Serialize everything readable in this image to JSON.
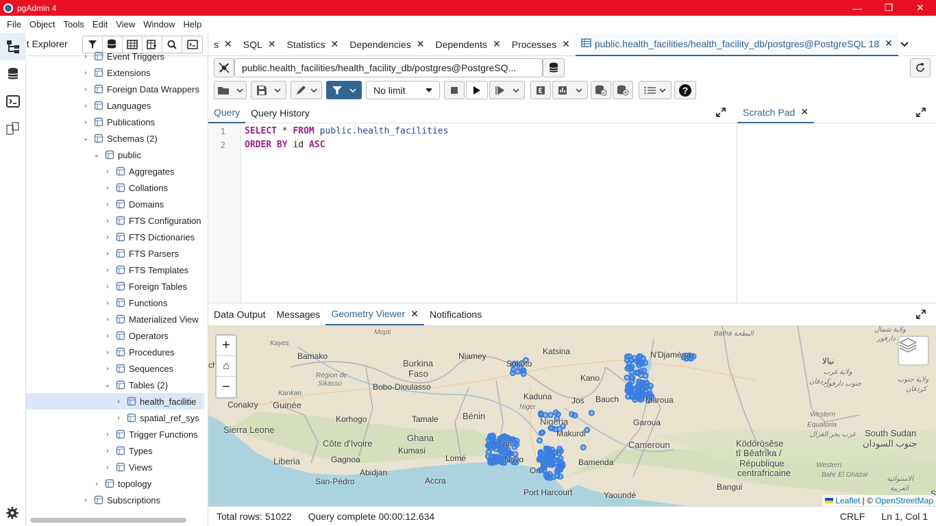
{
  "window": {
    "title": "pgAdmin 4",
    "controls": [
      "—",
      "❐",
      "✕"
    ]
  },
  "menu": [
    "File",
    "Object",
    "Tools",
    "Edit",
    "View",
    "Window",
    "Help"
  ],
  "browser": {
    "title": "ect Explorer",
    "tree": [
      {
        "label": "Event Triggers",
        "chev": "›",
        "icon": "event-triggers-icon"
      },
      {
        "label": "Extensions",
        "chev": "›",
        "icon": "extensions-icon"
      },
      {
        "label": "Foreign Data Wrappers",
        "chev": "›",
        "icon": "foreign-data-wrappers-icon"
      },
      {
        "label": "Languages",
        "chev": "›",
        "icon": "languages-icon"
      },
      {
        "label": "Publications",
        "chev": "›",
        "icon": "publications-icon"
      },
      {
        "label": "Schemas (2)",
        "chev": "⌄",
        "icon": "schemas-icon"
      },
      {
        "label": "public",
        "chev": "⌄",
        "icon": "schema-public-icon"
      },
      {
        "label": "Aggregates",
        "chev": "›",
        "icon": "aggregates-icon"
      },
      {
        "label": "Collations",
        "chev": "›",
        "icon": "collations-icon"
      },
      {
        "label": "Domains",
        "chev": "›",
        "icon": "domains-icon"
      },
      {
        "label": "FTS Configuration",
        "chev": "›",
        "icon": "fts-configuration-icon"
      },
      {
        "label": "FTS Dictionaries",
        "chev": "›",
        "icon": "fts-dictionaries-icon"
      },
      {
        "label": "FTS Parsers",
        "chev": "›",
        "icon": "fts-parsers-icon"
      },
      {
        "label": "FTS Templates",
        "chev": "›",
        "icon": "fts-templates-icon"
      },
      {
        "label": "Foreign Tables",
        "chev": "›",
        "icon": "foreign-tables-icon"
      },
      {
        "label": "Functions",
        "chev": "›",
        "icon": "functions-icon"
      },
      {
        "label": "Materialized View",
        "chev": "›",
        "icon": "materialized-views-icon"
      },
      {
        "label": "Operators",
        "chev": "›",
        "icon": "operators-icon"
      },
      {
        "label": "Procedures",
        "chev": "›",
        "icon": "procedures-icon"
      },
      {
        "label": "Sequences",
        "chev": "›",
        "icon": "sequences-icon"
      },
      {
        "label": "Tables (2)",
        "chev": "⌄",
        "icon": "tables-icon"
      },
      {
        "label": "health_facilitie",
        "chev": "›",
        "icon": "table-icon"
      },
      {
        "label": "spatial_ref_sys",
        "chev": "›",
        "icon": "table-icon"
      },
      {
        "label": "Trigger Functions",
        "chev": "›",
        "icon": "trigger-functions-icon"
      },
      {
        "label": "Types",
        "chev": "›",
        "icon": "types-icon"
      },
      {
        "label": "Views",
        "chev": "›",
        "icon": "views-icon"
      },
      {
        "label": "topology",
        "chev": "›",
        "icon": "schema-topology-icon"
      },
      {
        "label": "Subscriptions",
        "chev": "›",
        "icon": "subscriptions-icon"
      }
    ]
  },
  "tabs": [
    {
      "label": "s",
      "close": "✕"
    },
    {
      "label": "SQL",
      "close": "✕"
    },
    {
      "label": "Statistics",
      "close": "✕"
    },
    {
      "label": "Dependencies",
      "close": "✕"
    },
    {
      "label": "Dependents",
      "close": "✕"
    },
    {
      "label": "Processes",
      "close": "✕"
    },
    {
      "label": "public.health_facilities/health_facility_db/postgres@PostgreSQL 18",
      "close": "✕",
      "active": true
    }
  ],
  "connection": {
    "label": "public.health_facilities/health_facility_db/postgres@PostgreSQ..."
  },
  "toolbar": {
    "limit": "No limit"
  },
  "editor": {
    "tabs": [
      "Query",
      "Query History"
    ],
    "lines": [
      {
        "num": "1",
        "kw1": "SELECT",
        "plain": " * ",
        "kw2": "FROM",
        "ident": " public.health_facilities"
      },
      {
        "num": "2",
        "kw1": "ORDER BY",
        "plain": " id ",
        "kw2": "ASC",
        "ident": ""
      }
    ]
  },
  "scratch": {
    "title": "Scratch Pad",
    "close": "✕"
  },
  "results": {
    "tabs": [
      "Data Output",
      "Messages",
      "Geometry Viewer",
      "Notifications"
    ],
    "active_close": "✕"
  },
  "map": {
    "labels": [
      {
        "text": "Mopti",
        "cls": "region"
      },
      {
        "text": "Kayes",
        "cls": "region"
      },
      {
        "text": "Bamako",
        "cls": ""
      },
      {
        "text": "Niamey",
        "cls": ""
      },
      {
        "text": "Katsina",
        "cls": ""
      },
      {
        "text": "Sokoto",
        "cls": ""
      },
      {
        "text": "N'Djaména",
        "cls": ""
      },
      {
        "text": "Batha البطحة",
        "cls": "region"
      },
      {
        "text": "Burkina",
        "cls": "country"
      },
      {
        "text": "Faso",
        "cls": "country"
      },
      {
        "text": "Région de",
        "cls": "region"
      },
      {
        "text": "Sikasso",
        "cls": "region"
      },
      {
        "text": "Bobo-Dioulasso",
        "cls": ""
      },
      {
        "text": "Kano",
        "cls": ""
      },
      {
        "text": "Kaduna",
        "cls": ""
      },
      {
        "text": "Jos",
        "cls": ""
      },
      {
        "text": "Bauch",
        "cls": ""
      },
      {
        "text": "Maroua",
        "cls": ""
      },
      {
        "text": "Kankan",
        "cls": "region"
      },
      {
        "text": "Conakry",
        "cls": ""
      },
      {
        "text": "Guinée",
        "cls": "country"
      },
      {
        "text": "Niger",
        "cls": "region"
      },
      {
        "text": "Bénin",
        "cls": "country"
      },
      {
        "text": "Nigeria",
        "cls": "country"
      },
      {
        "text": "Korhogo",
        "cls": ""
      },
      {
        "text": "Tamale",
        "cls": ""
      },
      {
        "text": "Garoua",
        "cls": ""
      },
      {
        "text": "Sierra Leone",
        "cls": "country"
      },
      {
        "text": "Ghana",
        "cls": "country"
      },
      {
        "text": "Makurdi",
        "cls": ""
      },
      {
        "text": "Côte d'Ivoire",
        "cls": "country"
      },
      {
        "text": "Kumasi",
        "cls": ""
      },
      {
        "text": "Cameroun",
        "cls": "country"
      },
      {
        "text": "Liberia",
        "cls": "country"
      },
      {
        "text": "Gagnoa",
        "cls": ""
      },
      {
        "text": "Lomé",
        "cls": ""
      },
      {
        "text": "Bamenda",
        "cls": ""
      },
      {
        "text": "Abidjan",
        "cls": ""
      },
      {
        "text": "San-Pédro",
        "cls": ""
      },
      {
        "text": "Accra",
        "cls": ""
      },
      {
        "text": "Port Harcourt",
        "cls": ""
      },
      {
        "text": "Yaoundé",
        "cls": ""
      },
      {
        "text": "Ködörösêse",
        "cls": "country"
      },
      {
        "text": "tî Bêafrîka /",
        "cls": "country"
      },
      {
        "text": "République",
        "cls": "country"
      },
      {
        "text": "centrafricaine",
        "cls": "country"
      },
      {
        "text": "Bangui",
        "cls": ""
      },
      {
        "text": "South Sudan",
        "cls": "country"
      },
      {
        "text": "جنوب السودان",
        "cls": "country"
      },
      {
        "text": "Western",
        "cls": "region"
      },
      {
        "text": "Equatoria",
        "cls": "region"
      },
      {
        "text": "Western",
        "cls": "region"
      },
      {
        "text": "Bahr El Ghazal",
        "cls": "region"
      },
      {
        "text": "نيالا",
        "cls": ""
      },
      {
        "text": "ولاية غرب",
        "cls": "region"
      },
      {
        "text": "كردفان",
        "cls": "region"
      },
      {
        "text": "جنوب دارفور",
        "cls": "region"
      },
      {
        "text": "Novo",
        "cls": ""
      },
      {
        "text": "rin",
        "cls": ""
      },
      {
        "text": "On",
        "cls": ""
      },
      {
        "text": "ولاية شمال",
        "cls": "region"
      },
      {
        "text": "دارفور",
        "cls": "region"
      },
      {
        "text": "ولاية جنوب",
        "cls": "region"
      },
      {
        "text": "كردفان",
        "cls": "region"
      },
      {
        "text": "غرب بحر الغزال",
        "cls": "region"
      },
      {
        "text": "الاستوائية",
        "cls": "region"
      },
      {
        "text": "الغربية",
        "cls": "region"
      },
      {
        "text": "ch",
        "cls": ""
      },
      {
        "text": "Se",
        "cls": ""
      }
    ],
    "zoom": [
      "+",
      "⌂",
      "−"
    ],
    "attribution": {
      "leaflet": "Leaflet",
      "sep": " | © ",
      "osm": "OpenStreetMap"
    },
    "point_color": "#3a7fe0"
  },
  "status": {
    "rows": "Total rows: 51022",
    "query": "Query complete 00:00:12.634",
    "eol": "CRLF",
    "pos": "Ln 1, Col 1"
  }
}
